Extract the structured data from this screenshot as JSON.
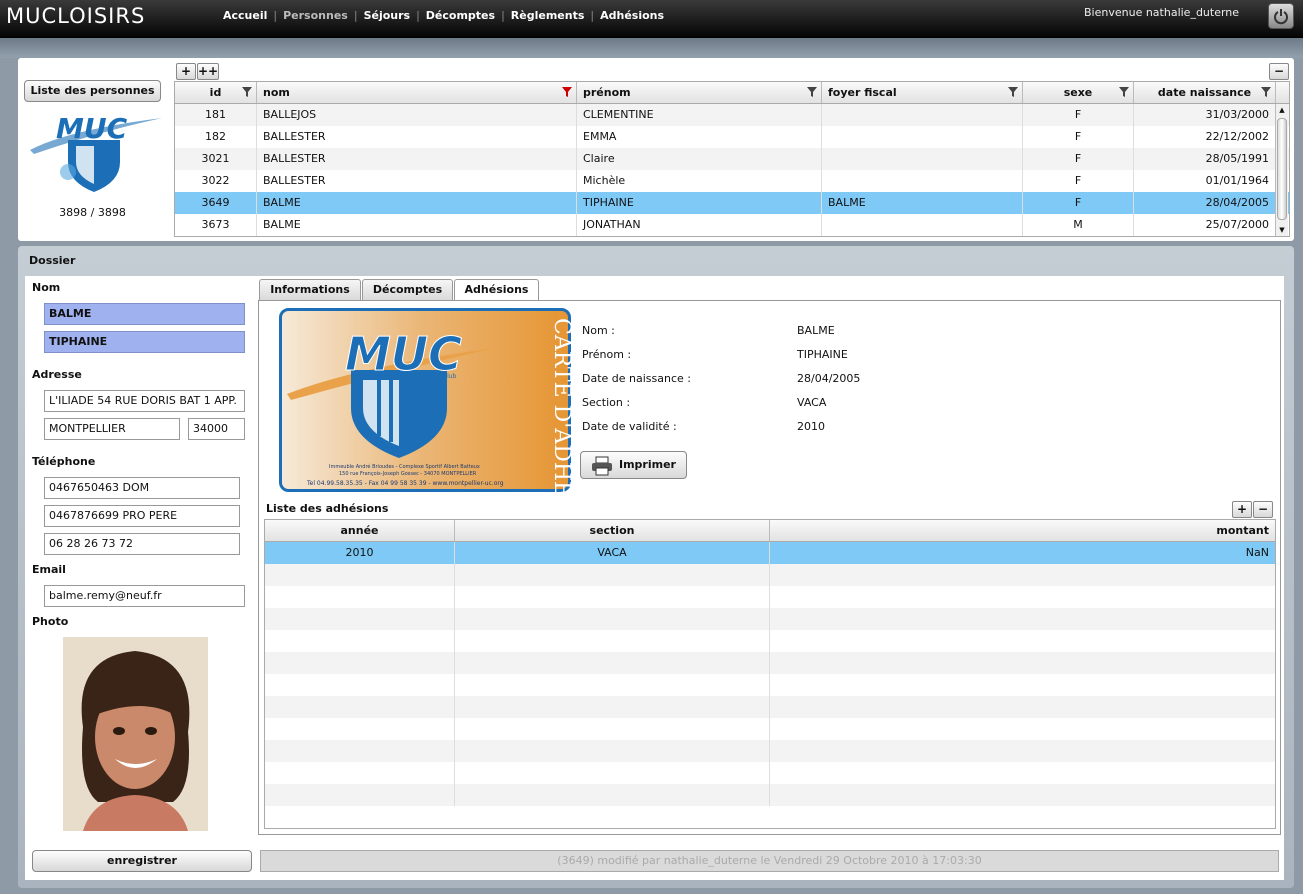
{
  "app": {
    "logo": "MUCLOISIRS",
    "welcome": "Bienvenue nathalie_duterne"
  },
  "nav": [
    "Accueil",
    "Personnes",
    "Séjours",
    "Décomptes",
    "Règlements",
    "Adhésions"
  ],
  "nav_active": "Personnes",
  "list": {
    "button": "Liste des personnes",
    "count": "3898 / 3898",
    "add": "+",
    "add_multi": "++",
    "collapse": "−",
    "columns": [
      "id",
      "nom",
      "prénom",
      "foyer fiscal",
      "sexe",
      "date naissance"
    ],
    "rows": [
      [
        "181",
        "BALLEJOS",
        "CLEMENTINE",
        "",
        "F",
        "31/03/2000"
      ],
      [
        "182",
        "BALLESTER",
        "EMMA",
        "",
        "F",
        "22/12/2002"
      ],
      [
        "3021",
        "BALLESTER",
        "Claire",
        "",
        "F",
        "28/05/1991"
      ],
      [
        "3022",
        "BALLESTER",
        "Michèle",
        "",
        "F",
        "01/01/1964"
      ],
      [
        "3649",
        "BALME",
        "TIPHAINE",
        "BALME",
        "F",
        "28/04/2005"
      ],
      [
        "3673",
        "BALME",
        "JONATHAN",
        "",
        "M",
        "25/07/2000"
      ]
    ],
    "selected": 4
  },
  "dossier": {
    "title": "Dossier",
    "nom_label": "Nom",
    "nom": "BALME",
    "prenom": "TIPHAINE",
    "adresse_label": "Adresse",
    "adresse": "L'ILIADE 54 RUE DORIS BAT 1 APP.",
    "ville": "MONTPELLIER",
    "cp": "34000",
    "tel_label": "Téléphone",
    "tel1": "0467650463 DOM",
    "tel2": "0467876699 PRO PERE",
    "tel3": "06 28 26 73 72",
    "email_label": "Email",
    "email": "balme.remy@neuf.fr",
    "photo_label": "Photo",
    "save": "enregistrer"
  },
  "tabs": [
    "Informations",
    "Décomptes",
    "Adhésions"
  ],
  "tab_active": "Adhésions",
  "card": {
    "muc": "MUC",
    "sub": "Montpellier Université Club",
    "vertical": "CARTE D'ADHÉRENT",
    "addr1": "Immeuble André Brioudes - Complexe Sportif Albert Batteux",
    "addr2": "150 rue François-Joseph Gossec - 34070 MONTPELLIER",
    "tel": "Tel 04.99.58.35.35 - Fax 04 99 58 35 39 - www.montpellier-uc.org"
  },
  "member": {
    "labels": [
      "Nom :",
      "Prénom :",
      "Date de naissance :",
      "Section :",
      "Date de validité :"
    ],
    "values": [
      "BALME",
      "TIPHAINE",
      "28/04/2005",
      "VACA",
      "2010"
    ],
    "print": "Imprimer"
  },
  "adhesions": {
    "title": "Liste des adhésions",
    "add": "+",
    "remove": "−",
    "columns": [
      "année",
      "section",
      "montant"
    ],
    "rows": [
      [
        "2010",
        "VACA",
        "NaN"
      ]
    ]
  },
  "status": "(3649) modifié par nathalie_duterne le Vendredi 29 Octobre 2010 à 17:03:30",
  "colors": {
    "selected": "#7fc9f7",
    "highlight": "#9fb1ee",
    "card_orange": "#e9a04d",
    "card_blue": "#1c6fb6"
  }
}
